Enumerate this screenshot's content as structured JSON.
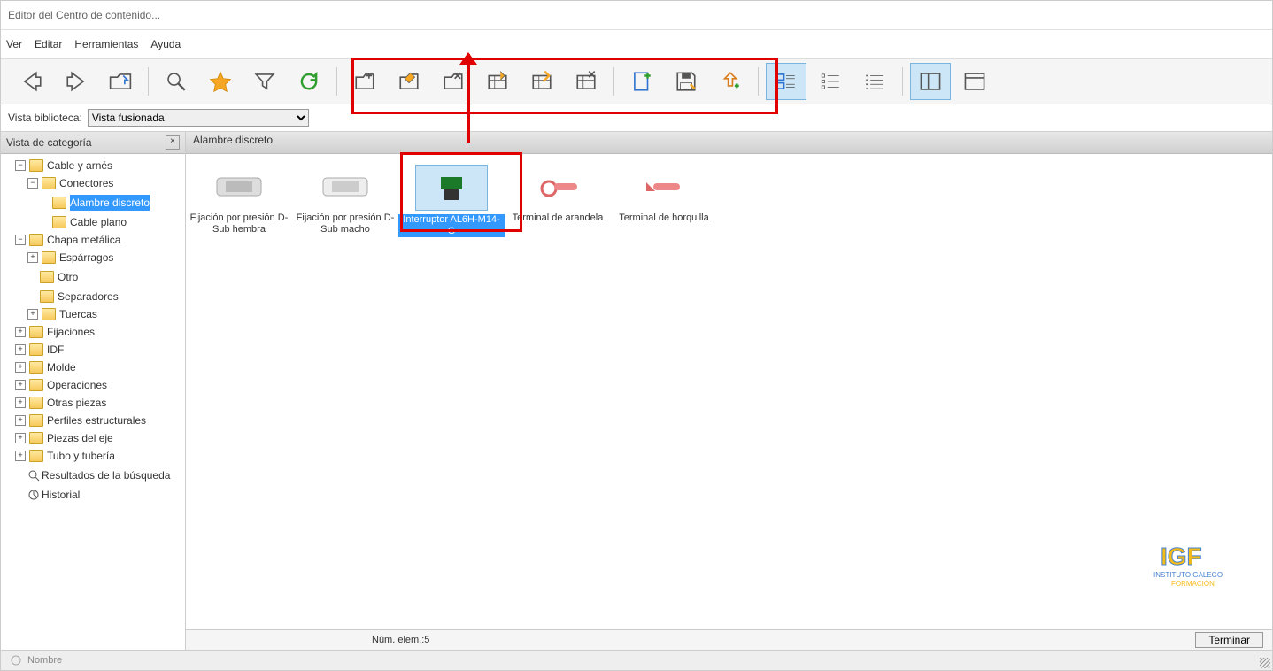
{
  "title": "Editor del Centro de contenido...",
  "menus": {
    "ver": "Ver",
    "editar": "Editar",
    "herr": "Herramientas",
    "ayuda": "Ayuda"
  },
  "libview": {
    "label": "Vista biblioteca:",
    "selected": "Vista fusionada"
  },
  "catpanel": {
    "title": "Vista de categoría"
  },
  "rightpanel": {
    "title": "Alambre discreto"
  },
  "tree": {
    "cable": "Cable y arnés",
    "conectores": "Conectores",
    "alambre": "Alambre discreto",
    "cableplano": "Cable plano",
    "chapa": "Chapa metálica",
    "esparragos": "Espárragos",
    "otro": "Otro",
    "separadores": "Separadores",
    "tuercas": "Tuercas",
    "fijaciones": "Fijaciones",
    "idf": "IDF",
    "molde": "Molde",
    "operaciones": "Operaciones",
    "otras": "Otras piezas",
    "perfiles": "Perfiles estructurales",
    "piezas": "Piezas del eje",
    "tubo": "Tubo y tubería",
    "resultados": "Resultados de la búsqueda",
    "historial": "Historial"
  },
  "items": [
    {
      "label": "Fijación por presión D-Sub hembra"
    },
    {
      "label": "Fijación por presión D-Sub macho"
    },
    {
      "label": "Interruptor AL6H-M14-G"
    },
    {
      "label": "Terminal de arandela"
    },
    {
      "label": "Terminal de horquilla"
    }
  ],
  "status": {
    "count": "Núm. elem.:5",
    "terminar": "Terminar"
  },
  "bottom": {
    "nombre": "Nombre"
  },
  "watermark": {
    "l1": "IGF",
    "l2": "INSTITUTO GALEGO",
    "l3": "FORMACIÓN"
  }
}
